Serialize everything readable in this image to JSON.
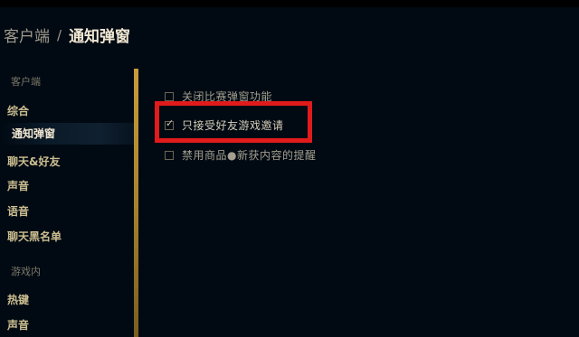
{
  "header": {
    "parent": "客户端",
    "separator": "/",
    "current": "通知弹窗"
  },
  "sidebar": {
    "section_client": "客户端",
    "items_client": [
      {
        "label": "综合"
      },
      {
        "label": "通知弹窗"
      },
      {
        "label": "聊天&好友"
      },
      {
        "label": "声音"
      },
      {
        "label": "语音"
      },
      {
        "label": "聊天黑名单"
      }
    ],
    "section_ingame": "游戏内",
    "items_ingame": [
      {
        "label": "热键"
      },
      {
        "label": "声音"
      }
    ]
  },
  "options": [
    {
      "label": "关闭比赛弹窗功能",
      "checked": false
    },
    {
      "label": "只接受好友游戏邀请",
      "checked": true
    },
    {
      "label": "禁用商品●新获内容的提醒",
      "checked": false
    }
  ],
  "colors": {
    "background": "#010a13",
    "gold_divider": "#c89b3c",
    "highlight_red": "#e11b1b"
  }
}
